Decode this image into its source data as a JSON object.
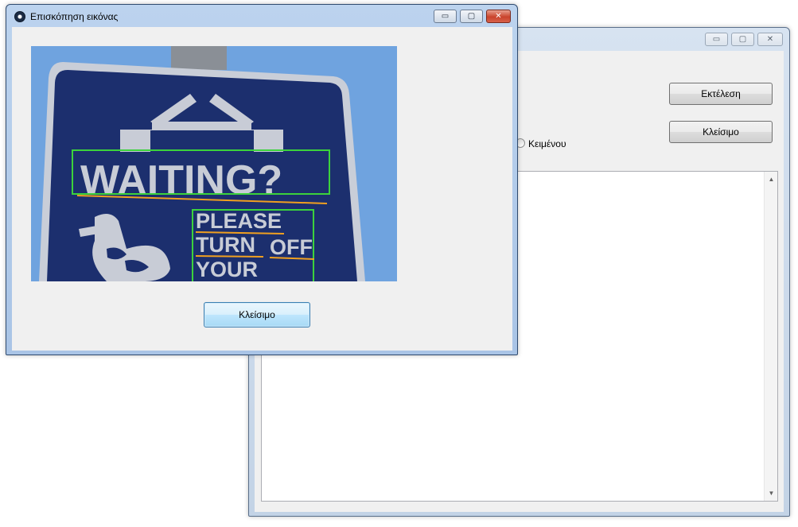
{
  "back_window": {
    "title": "",
    "controls": {
      "minimize": "▭",
      "maximize": "▢",
      "close": "✕"
    },
    "run_button": "Εκτέλεση",
    "close_button": "Κλείσιμο",
    "radio_text_label": "Κειμένου",
    "scroll_up": "▲",
    "scroll_down": "▼"
  },
  "front_window": {
    "title": "Επισκόπηση  εικόνας",
    "controls": {
      "minimize": "▭",
      "maximize": "▢",
      "close": "✕"
    },
    "close_button": "Κλείσιμο",
    "image": {
      "sign_line_1": "WAITING?",
      "sign_line_2": "PLEASE",
      "sign_line_3": "TURN",
      "sign_line_4": "OFF",
      "sign_line_5": "YOUR"
    }
  },
  "colors": {
    "sky": "#6fa3df",
    "sign_blue": "#1c2f6e",
    "sign_text": "#c8ccd6",
    "detect_box": "#3cd23c",
    "word_underline": "#f0a020"
  }
}
